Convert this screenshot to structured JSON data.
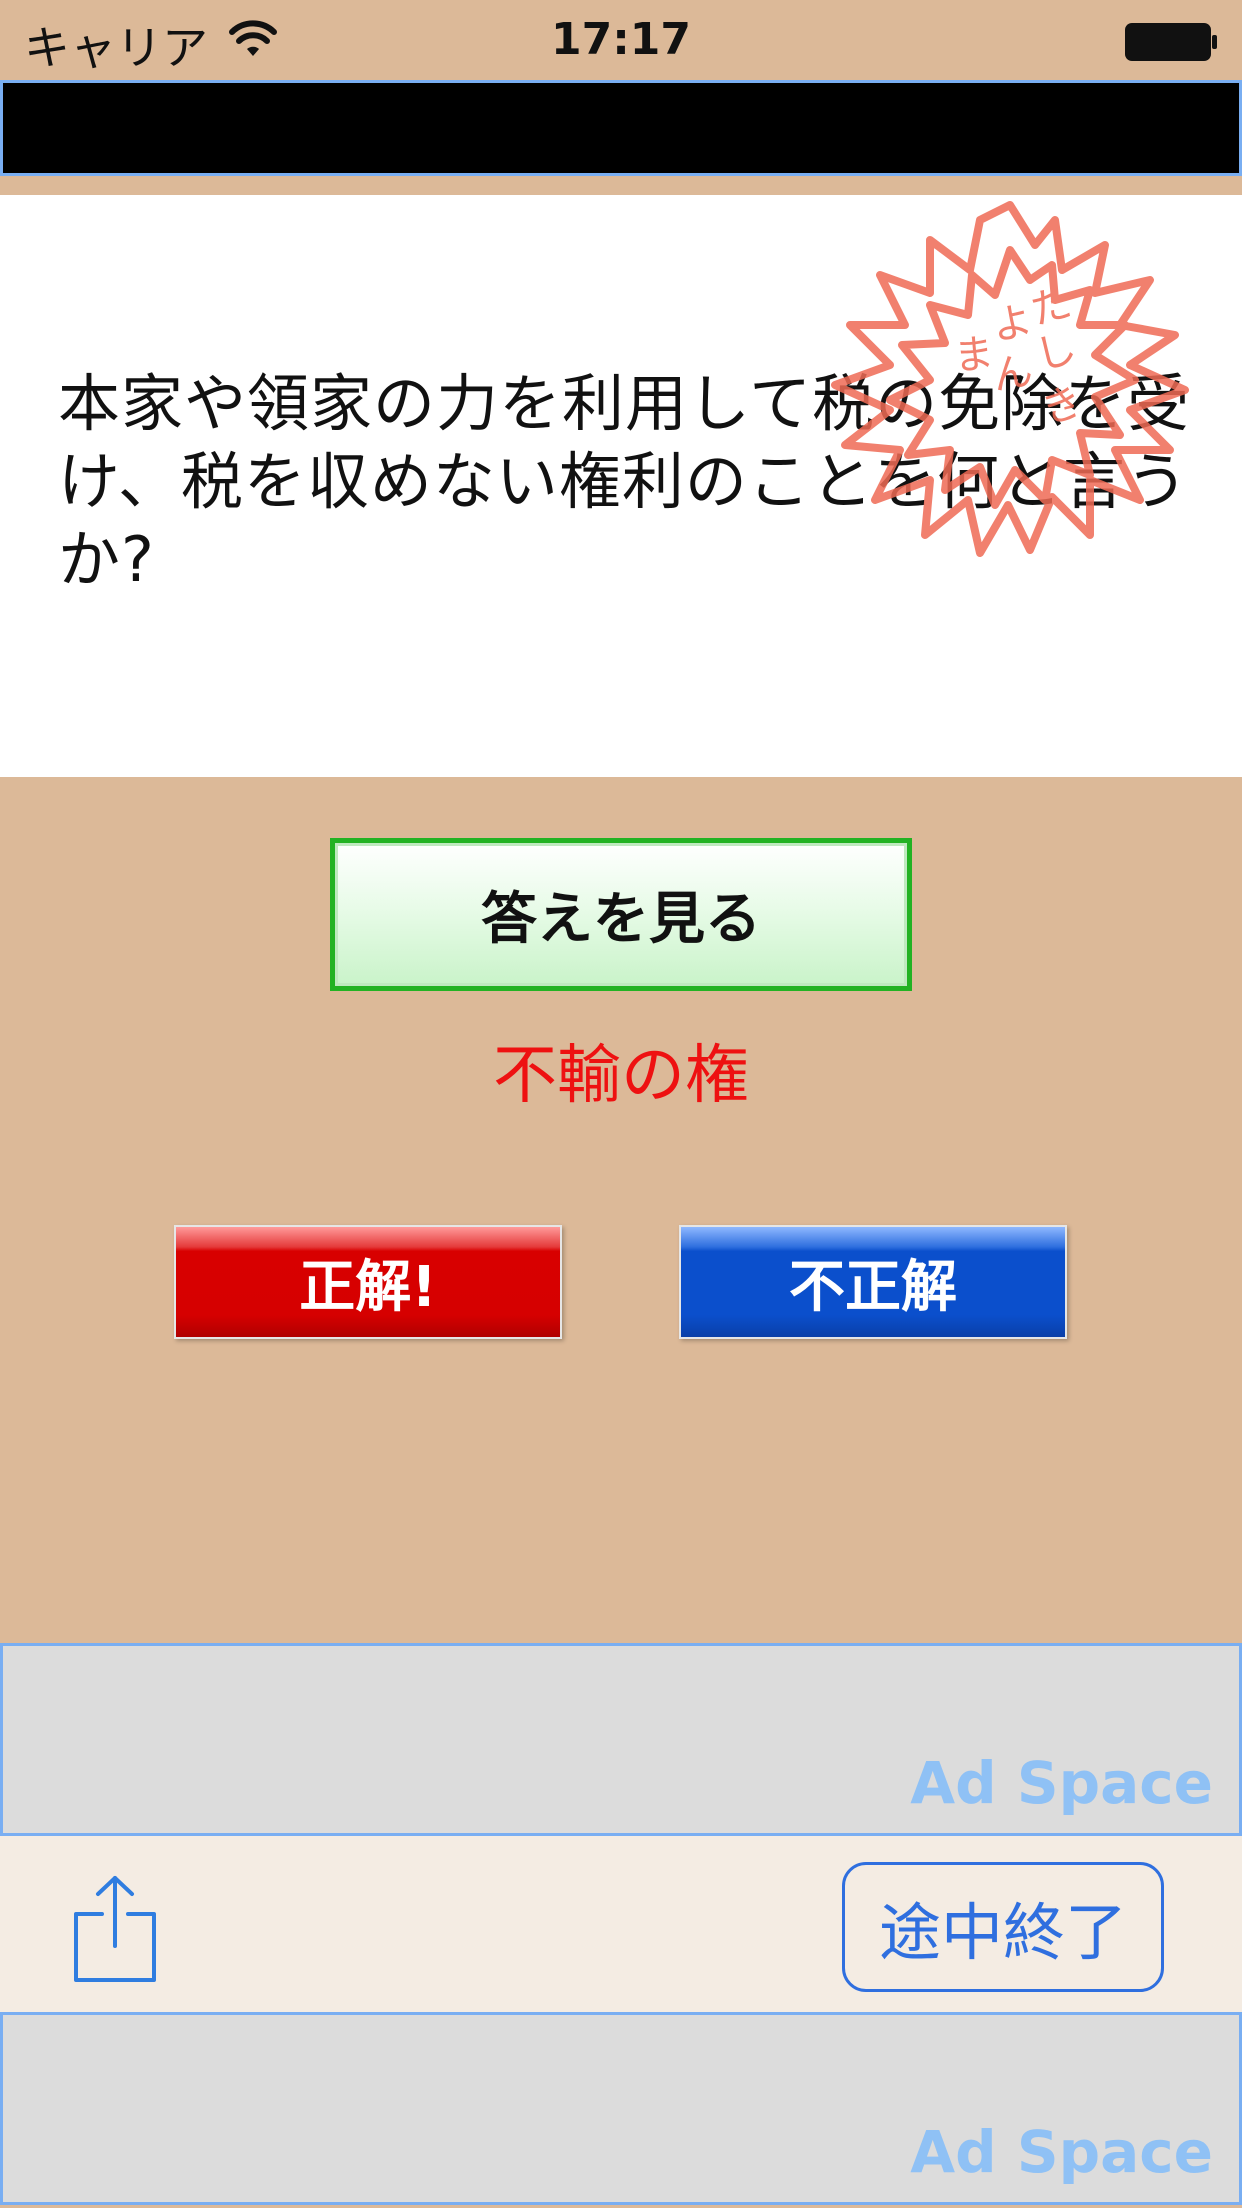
{
  "status_bar": {
    "carrier": "キャリア",
    "time": "17:17"
  },
  "question": {
    "text": "本家や領家の力を利用して税の免除を受け、税を収めない権利のことを何と言うか?",
    "stamp_text": "まよた しんき"
  },
  "buttons": {
    "show_answer": "答えを見る",
    "correct": "正解!",
    "wrong": "不正解",
    "quit": "途中終了"
  },
  "answer": "不輸の権",
  "ads": {
    "top_label": "Ad Space",
    "bottom_label": "Ad Space"
  },
  "colors": {
    "background": "#dcb998",
    "answer_red": "#ee1111",
    "correct_red": "#d80000",
    "wrong_blue": "#0b4fcc",
    "show_answer_border": "#23b223",
    "ad_border": "#79aef2",
    "ad_text": "#8fc1f5"
  },
  "icons": {
    "wifi": "wifi-icon",
    "battery": "battery-icon",
    "share": "share-icon",
    "stamp": "sakura-stamp-icon"
  }
}
